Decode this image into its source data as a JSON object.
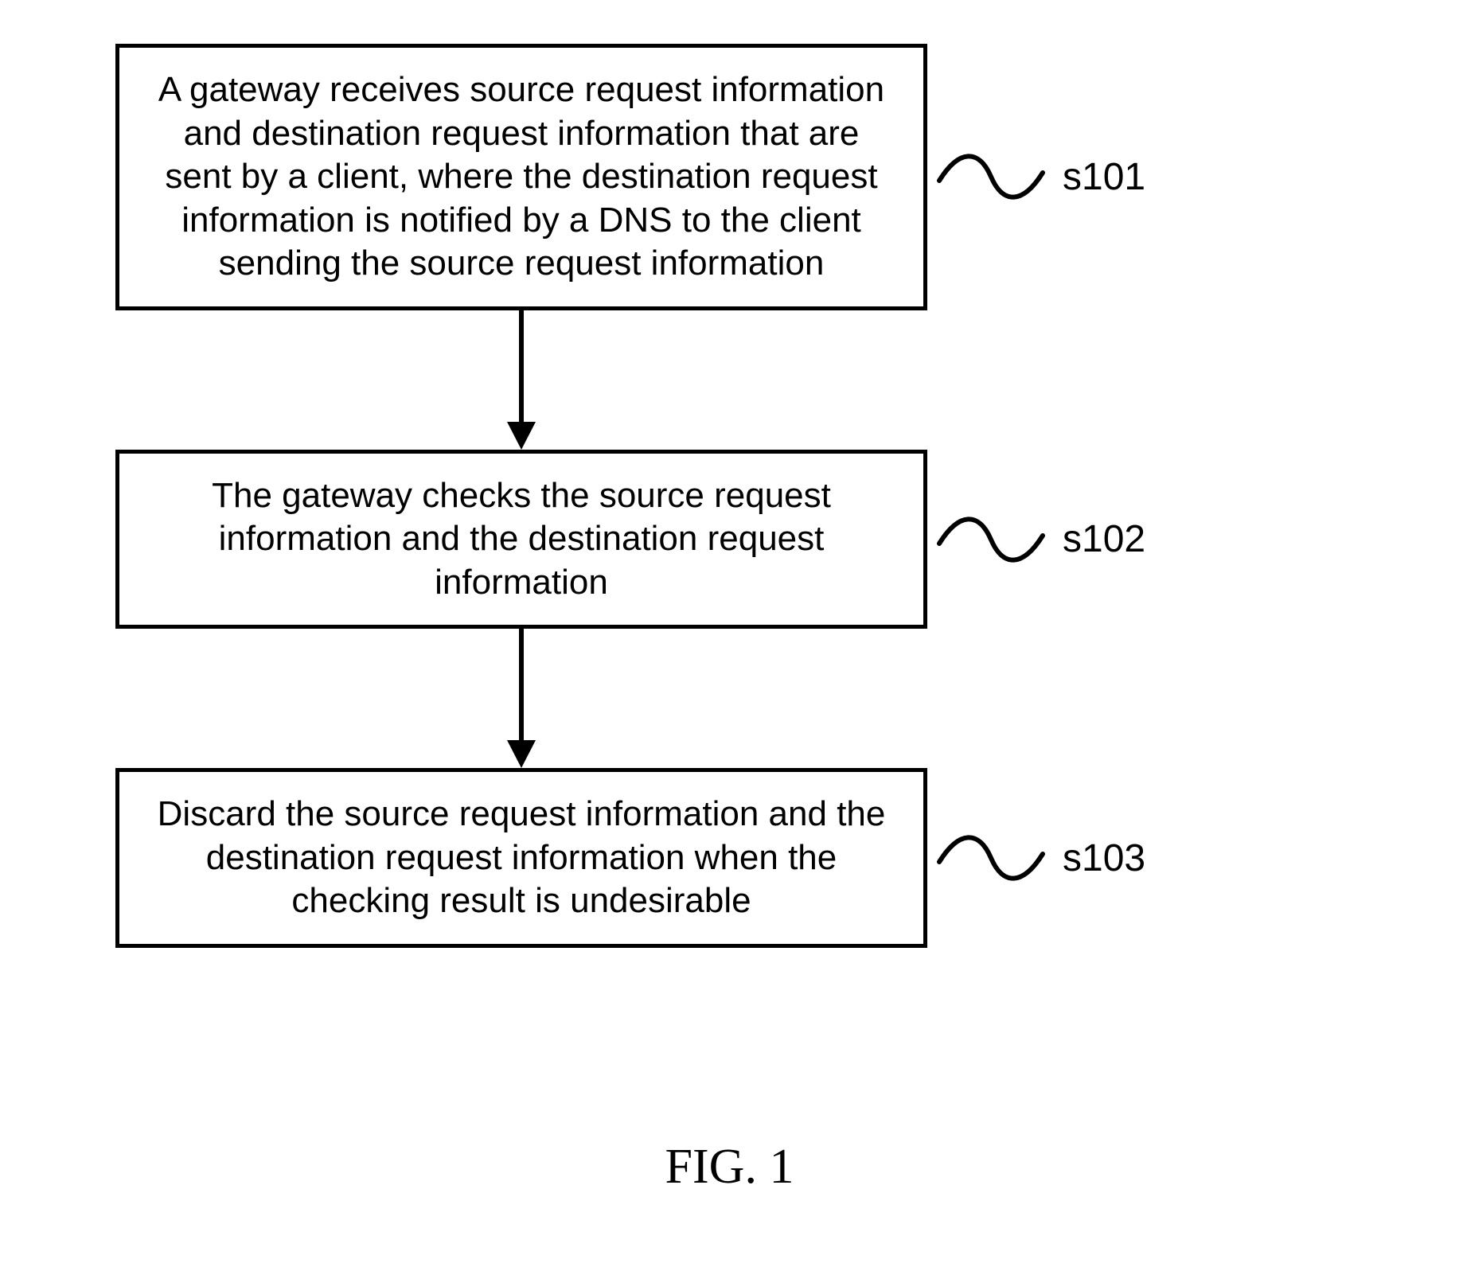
{
  "flowchart": {
    "steps": [
      {
        "label": "s101",
        "text": "A gateway receives source request information and destination request information that are sent by a client, where the destination request information is notified by a DNS to the client sending the source request information"
      },
      {
        "label": "s102",
        "text": "The gateway checks the source request information and the destination request information"
      },
      {
        "label": "s103",
        "text": "Discard the source request information and the destination request information when the checking result is undesirable"
      }
    ],
    "caption": "FIG. 1"
  }
}
